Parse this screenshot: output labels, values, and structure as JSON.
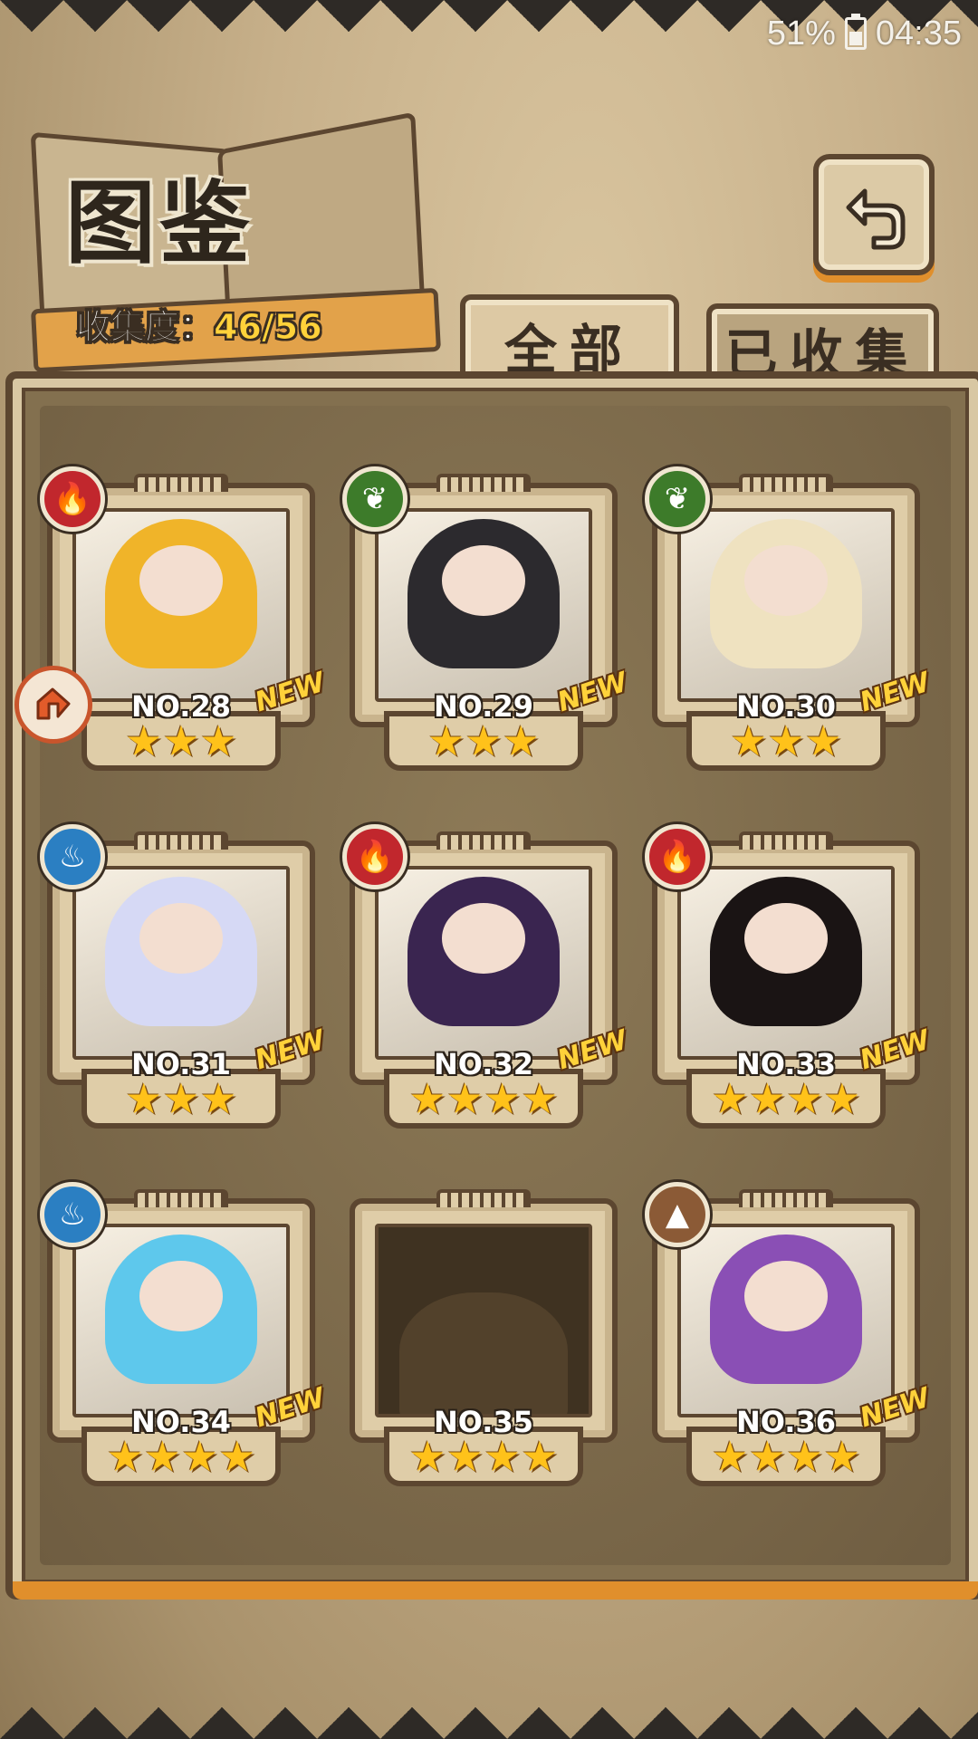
{
  "status_bar": {
    "battery": "51%",
    "time": "04:35"
  },
  "header": {
    "title": "图鉴",
    "collection_label": "收集度：",
    "collection_value": "46/56"
  },
  "tabs": [
    {
      "label": "全部",
      "active": true
    },
    {
      "label": "已收集",
      "active": false
    }
  ],
  "cards": [
    {
      "number": "NO.28",
      "element": "fire-icon",
      "stars": "★★★",
      "new": "NEW",
      "hair": "#f0b429"
    },
    {
      "number": "NO.29",
      "element": "leaf-icon",
      "stars": "★★★",
      "new": "NEW",
      "hair": "#2c2a2e"
    },
    {
      "number": "NO.30",
      "element": "leaf-icon",
      "stars": "★★★",
      "new": "NEW",
      "hair": "#efe2c0"
    },
    {
      "number": "NO.31",
      "element": "water-icon",
      "stars": "★★★",
      "new": "NEW",
      "hair": "#d6d9f5"
    },
    {
      "number": "NO.32",
      "element": "fire-icon",
      "stars": "★★★★",
      "new": "NEW",
      "hair": "#3a2550"
    },
    {
      "number": "NO.33",
      "element": "fire-icon",
      "stars": "★★★★",
      "new": "NEW",
      "hair": "#1a1414"
    },
    {
      "number": "NO.34",
      "element": "water-icon",
      "stars": "★★★★",
      "new": "NEW",
      "hair": "#5ec8ec"
    },
    {
      "number": "NO.35",
      "element": "",
      "stars": "★★★★",
      "new": "",
      "hair": ""
    },
    {
      "number": "NO.36",
      "element": "earth-icon",
      "stars": "★★★★",
      "new": "NEW",
      "hair": "#8a4fb5"
    }
  ],
  "colors": {
    "fire": "#c1272d",
    "leaf": "#3d7b2a",
    "water": "#2b7fc2",
    "earth": "#8b5a36",
    "gold": "#ffd23a"
  }
}
